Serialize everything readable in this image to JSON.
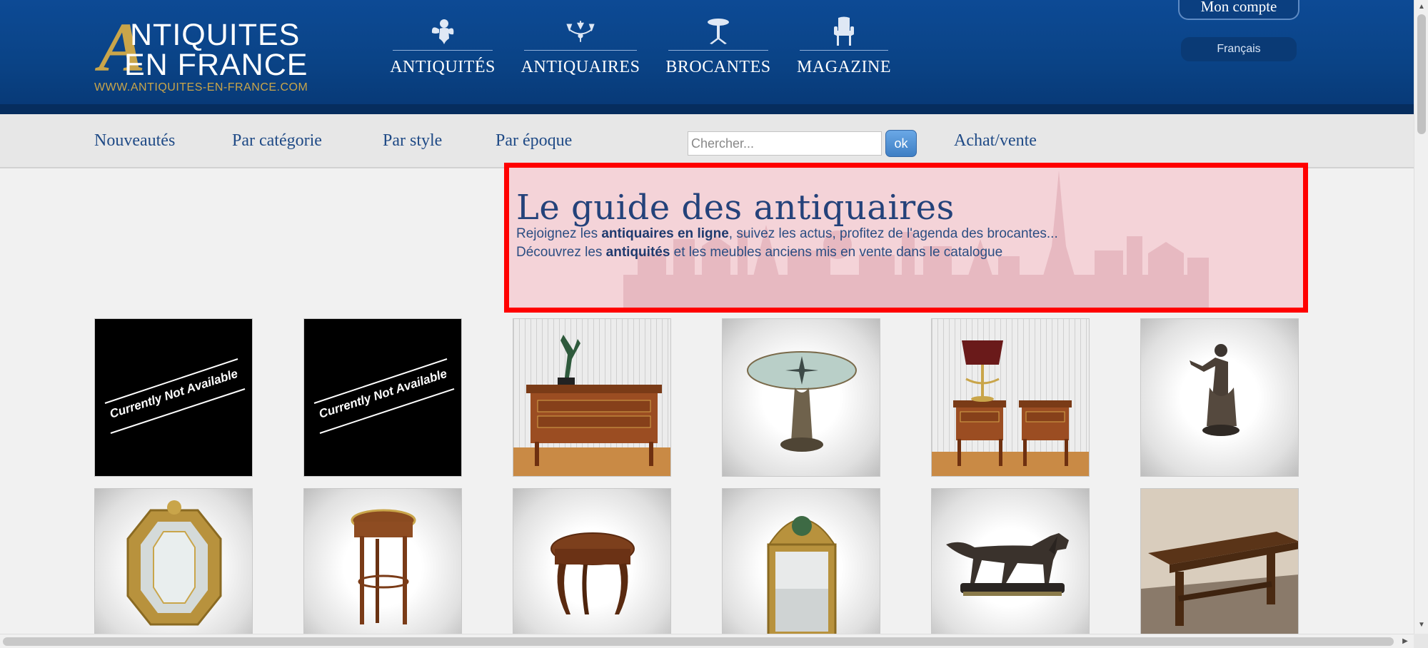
{
  "header": {
    "logo": {
      "letter_a": "A",
      "line1": "NTIQUITES",
      "line2": "EN FRANCE",
      "url": "WWW.ANTIQUITES-EN-FRANCE.COM"
    },
    "nav": [
      {
        "label": "ANTIQUITÉS",
        "icon": "cherub-icon"
      },
      {
        "label": "ANTIQUAIRES",
        "icon": "chandelier-icon"
      },
      {
        "label": "BROCANTES",
        "icon": "pedestal-table-icon"
      },
      {
        "label": "MAGAZINE",
        "icon": "armchair-icon"
      }
    ],
    "account_label": "Mon compte",
    "language_label": "Français"
  },
  "subnav": {
    "links": [
      "Nouveautés",
      "Par catégorie",
      "Par style",
      "Par époque"
    ],
    "search_placeholder": "Chercher...",
    "search_button": "ok",
    "buy_sell": "Achat/vente"
  },
  "hero": {
    "title": "Le guide des antiquaires",
    "line1_prefix": "Rejoignez les ",
    "line1_bold": "antiquaires en ligne",
    "line1_suffix": ", suivez les actus, profitez de l'agenda des brocantes...",
    "line2_prefix": "Découvrez les ",
    "line2_bold": "antiquités",
    "line2_suffix": " et les meubles anciens mis en vente dans le catalogue"
  },
  "products": {
    "unavailable_text": "Currently Not Available",
    "row1": [
      "unavailable",
      "unavailable",
      "commode-with-statue",
      "compass-pedestal-table",
      "nightstands-with-lamp",
      "bronze-statue"
    ],
    "row2": [
      "gilt-octagonal-mirror",
      "round-side-table",
      "marquetry-side-table",
      "gilt-pediment-mirror",
      "bronze-dog-sculpture",
      "farm-table"
    ]
  },
  "colors": {
    "header_blue": "#0d4a95",
    "gold": "#c9a54a",
    "link_blue": "#1f4a86",
    "highlight_red": "#ff0000",
    "highlight_fill": "#f4d3d8"
  }
}
